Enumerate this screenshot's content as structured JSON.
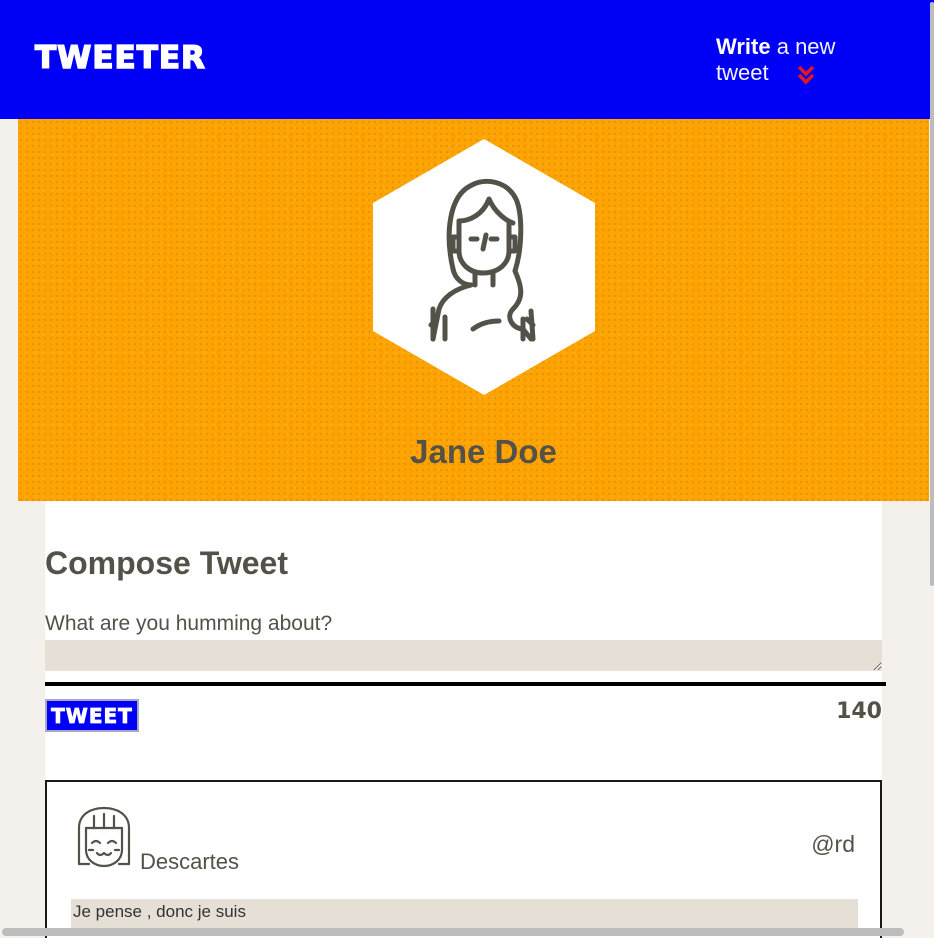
{
  "nav": {
    "brand": "TWEETER",
    "write_bold": "Write",
    "write_rest": " a new tweet",
    "chevron_icon": "double-chevron-down-icon",
    "accent": "#0000f6",
    "chevron_color": "#e0191c"
  },
  "profile": {
    "name": "Jane Doe",
    "avatar_icon": "woman-avatar-icon",
    "banner_color": "#fea402"
  },
  "compose": {
    "title": "Compose Tweet",
    "prompt": "What are you humming about?",
    "value": "",
    "button_label": "TWEET",
    "counter": "140"
  },
  "tweets": [
    {
      "author": "Descartes",
      "handle": "@rd",
      "text": "Je pense , donc je suis",
      "avatar_icon": "smiling-girl-avatar-icon"
    }
  ]
}
